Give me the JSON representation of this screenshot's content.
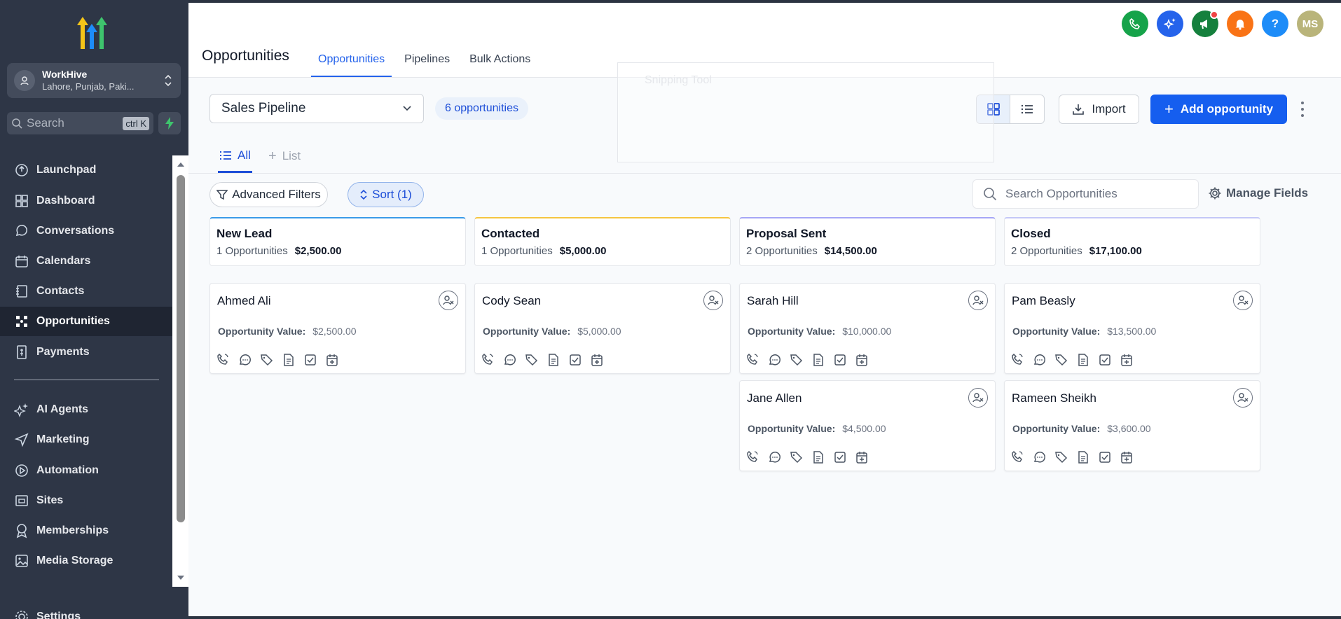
{
  "sidebar": {
    "account": {
      "name": "WorkHive",
      "location": "Lahore, Punjab, Paki..."
    },
    "search": {
      "placeholder": "Search",
      "shortcut": "ctrl K"
    },
    "items": [
      {
        "label": "Launchpad",
        "icon": "launchpad-icon"
      },
      {
        "label": "Dashboard",
        "icon": "dashboard-icon"
      },
      {
        "label": "Conversations",
        "icon": "chat-icon"
      },
      {
        "label": "Calendars",
        "icon": "calendar-icon"
      },
      {
        "label": "Contacts",
        "icon": "contacts-icon"
      },
      {
        "label": "Opportunities",
        "icon": "opportunities-icon",
        "active": true
      },
      {
        "label": "Payments",
        "icon": "payments-icon"
      },
      {
        "label": "AI Agents",
        "icon": "sparkle-icon"
      },
      {
        "label": "Marketing",
        "icon": "send-icon"
      },
      {
        "label": "Automation",
        "icon": "automation-icon"
      },
      {
        "label": "Sites",
        "icon": "sites-icon"
      },
      {
        "label": "Memberships",
        "icon": "badge-icon"
      },
      {
        "label": "Media Storage",
        "icon": "image-icon"
      },
      {
        "label": "Settings",
        "icon": "gear-icon"
      }
    ]
  },
  "header": {
    "title": "Opportunities",
    "tabs": [
      "Opportunities",
      "Pipelines",
      "Bulk Actions"
    ],
    "avatar_initials": "MS",
    "icon_colors": {
      "phone": "#16a34a",
      "ai": "#2563eb",
      "announce": "#15803d",
      "bell": "#f97316",
      "help": "#1d8cf8",
      "avatar": "#b9b47a"
    }
  },
  "toolbar": {
    "pipeline": "Sales Pipeline",
    "count": "6 opportunities",
    "import_label": "Import",
    "add_label": "Add opportunity"
  },
  "overlay": {
    "label": "Snipping Tool"
  },
  "views": {
    "all": "All",
    "list": "List"
  },
  "filters": {
    "advanced": "Advanced Filters",
    "sort": "Sort (1)",
    "search_placeholder": "Search Opportunities",
    "manage_fields": "Manage Fields"
  },
  "value_label": "Opportunity Value:",
  "columns": [
    {
      "title": "New Lead",
      "count": "1 Opportunities",
      "total": "$2,500.00",
      "accent": "#3b9be8",
      "cards": [
        {
          "name": "Ahmed Ali",
          "value": "$2,500.00"
        }
      ]
    },
    {
      "title": "Contacted",
      "count": "1 Opportunities",
      "total": "$5,000.00",
      "accent": "#f5c542",
      "cards": [
        {
          "name": "Cody Sean",
          "value": "$5,000.00"
        }
      ]
    },
    {
      "title": "Proposal Sent",
      "count": "2 Opportunities",
      "total": "$14,500.00",
      "accent": "#a5a6f6",
      "cards": [
        {
          "name": "Sarah Hill",
          "value": "$10,000.00"
        },
        {
          "name": "Jane Allen",
          "value": "$4,500.00"
        }
      ]
    },
    {
      "title": "Closed",
      "count": "2 Opportunities",
      "total": "$17,100.00",
      "accent": "#c4c8f7",
      "cards": [
        {
          "name": "Pam Beasly",
          "value": "$13,500.00"
        },
        {
          "name": "Rameen Sheikh",
          "value": "$3,600.00"
        }
      ]
    }
  ]
}
